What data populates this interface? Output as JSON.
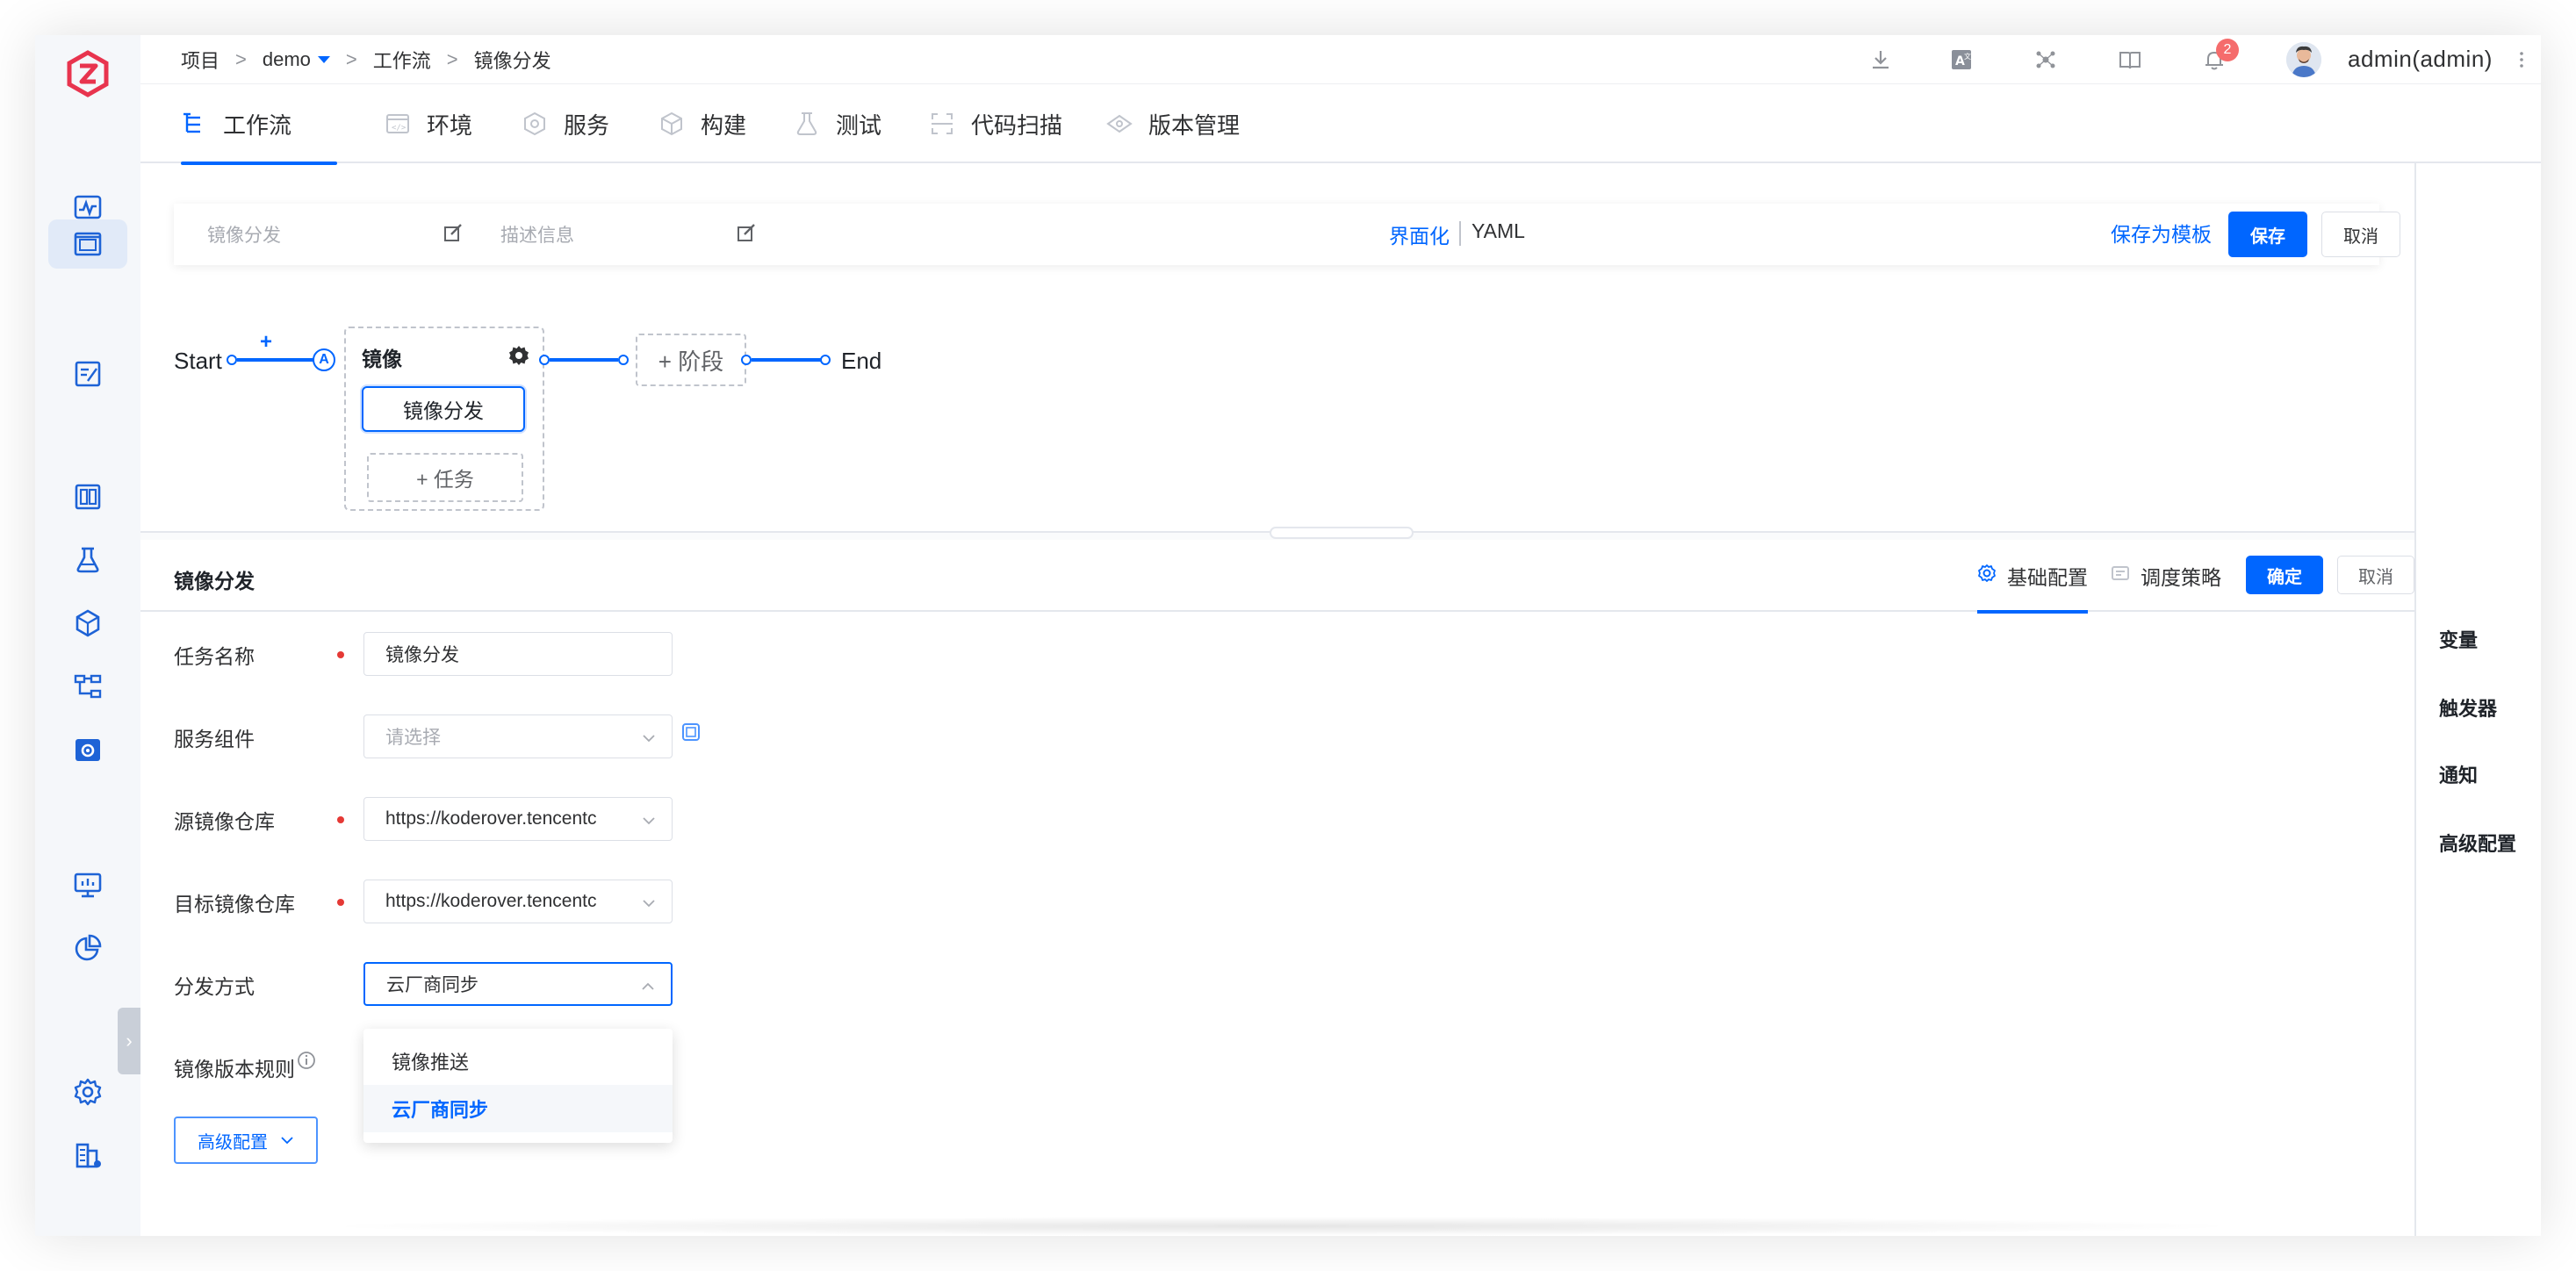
{
  "breadcrumb": {
    "project": "项目",
    "sep1": ">",
    "project_name": "demo",
    "sep2": ">",
    "section": "工作流",
    "sep3": ">",
    "current": "镜像分发"
  },
  "header": {
    "notification_count": "2",
    "user_name": "admin(admin)"
  },
  "nav_tabs": [
    {
      "label": "工作流",
      "icon": "workflow-icon"
    },
    {
      "label": "环境",
      "icon": "environment-icon"
    },
    {
      "label": "服务",
      "icon": "service-icon"
    },
    {
      "label": "构建",
      "icon": "build-icon"
    },
    {
      "label": "测试",
      "icon": "test-icon"
    },
    {
      "label": "代码扫描",
      "icon": "code-scan-icon"
    },
    {
      "label": "版本管理",
      "icon": "version-icon"
    }
  ],
  "toolbar": {
    "name_placeholder": "镜像分发",
    "desc_placeholder": "描述信息",
    "mode_ui": "界面化",
    "mode_yaml": "YAML",
    "save_template": "保存为模板",
    "save": "保存",
    "cancel": "取消"
  },
  "workflow": {
    "start": "Start",
    "plus": "+",
    "approval_marker": "A",
    "stage_name": "镜像",
    "task_name": "镜像分发",
    "add_task": "+ 任务",
    "add_stage": "+ 阶段",
    "end": "End"
  },
  "right_panel": {
    "items": [
      "变量",
      "触发器",
      "通知",
      "高级配置"
    ]
  },
  "config": {
    "title": "镜像分发",
    "tab_basic": "基础配置",
    "tab_schedule": "调度策略",
    "confirm": "确定",
    "cancel": "取消",
    "fields": {
      "task_name_label": "任务名称",
      "task_name_value": "镜像分发",
      "service_label": "服务组件",
      "service_placeholder": "请选择",
      "source_label": "源镜像仓库",
      "source_value": "https://koderover.tencentc",
      "target_label": "目标镜像仓库",
      "target_value": "https://koderover.tencentc",
      "method_label": "分发方式",
      "method_value": "云厂商同步",
      "version_rule_label": "镜像版本规则"
    },
    "method_options": [
      "镜像推送",
      "云厂商同步"
    ],
    "advanced_button": "高级配置"
  },
  "colors": {
    "primary": "#0066ff",
    "required": "#e53935",
    "badge": "#f56c6c",
    "brand": "#e8344e"
  }
}
